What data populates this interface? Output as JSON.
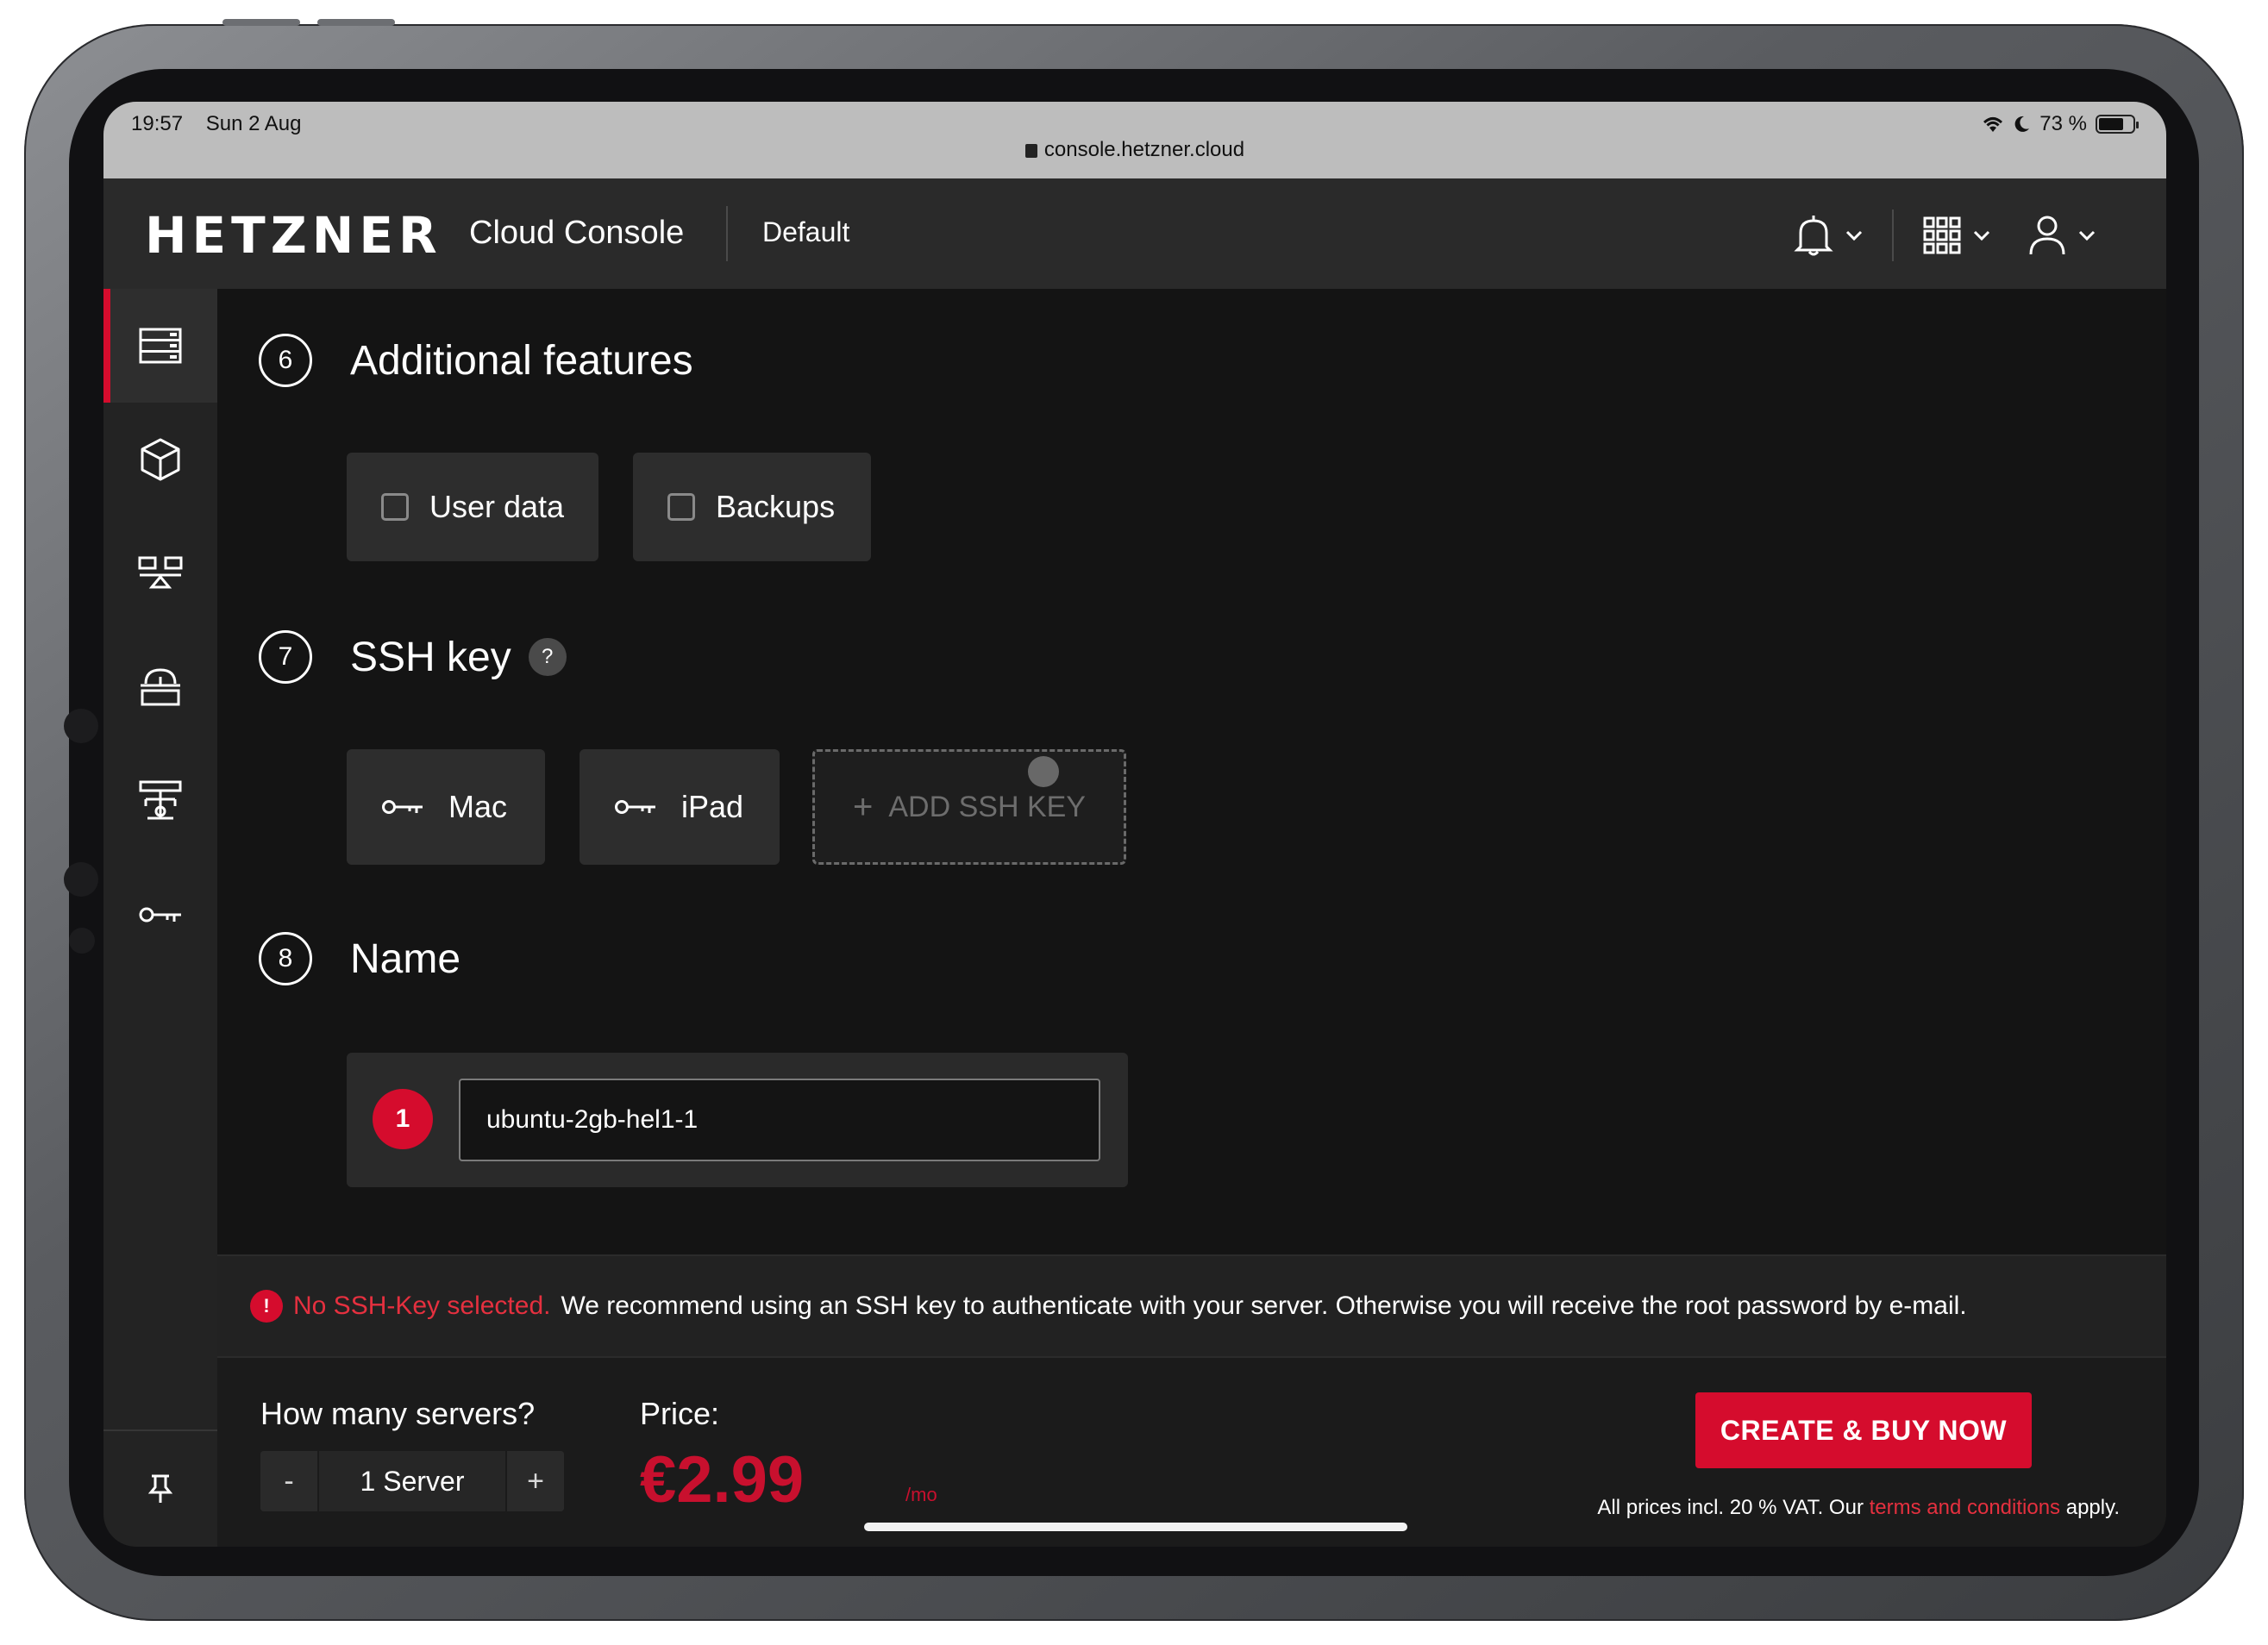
{
  "status_bar": {
    "time": "19:57",
    "date": "Sun 2 Aug",
    "url": "console.hetzner.cloud",
    "battery": "73 %",
    "battery_level": 0.73
  },
  "header": {
    "logo": "HETZNER",
    "app_title": "Cloud Console",
    "project": "Default"
  },
  "sidebar": {
    "items": [
      {
        "icon": "server-icon",
        "active": true
      },
      {
        "icon": "volume-cube-icon",
        "active": false
      },
      {
        "icon": "load-balancer-icon",
        "active": false
      },
      {
        "icon": "floating-ip-icon",
        "active": false
      },
      {
        "icon": "network-icon",
        "active": false
      },
      {
        "icon": "ssh-key-icon",
        "active": false
      }
    ],
    "pin_icon": "pin-icon"
  },
  "sections": {
    "additional": {
      "number": "6",
      "title": "Additional features",
      "options": [
        {
          "label": "User data",
          "checked": false
        },
        {
          "label": "Backups",
          "checked": false
        }
      ]
    },
    "ssh": {
      "number": "7",
      "title": "SSH key",
      "help": "?",
      "keys": [
        "Mac",
        "iPad"
      ],
      "add_label": "ADD SSH KEY",
      "add_symbol": "+"
    },
    "name": {
      "number": "8",
      "title": "Name",
      "badge": "1",
      "value": "ubuntu-2gb-hel1-1"
    }
  },
  "warning": {
    "icon": "!",
    "strong": "No SSH-Key selected.",
    "text": "We recommend using an SSH key to authenticate with your server. Otherwise you will receive the root password by e-mail."
  },
  "footer": {
    "servers_label": "How many servers?",
    "minus": "-",
    "count": "1 Server",
    "plus": "+",
    "price_label": "Price:",
    "price": "€2.99",
    "per": "/mo",
    "buy_label": "CREATE & BUY NOW",
    "vat_prefix": "All prices incl. 20 % VAT. Our",
    "vat_link": "terms and conditions",
    "vat_suffix": "apply."
  },
  "colors": {
    "brand_red": "#d50c2d",
    "background": "#141414",
    "panel": "#2d2d2d"
  }
}
